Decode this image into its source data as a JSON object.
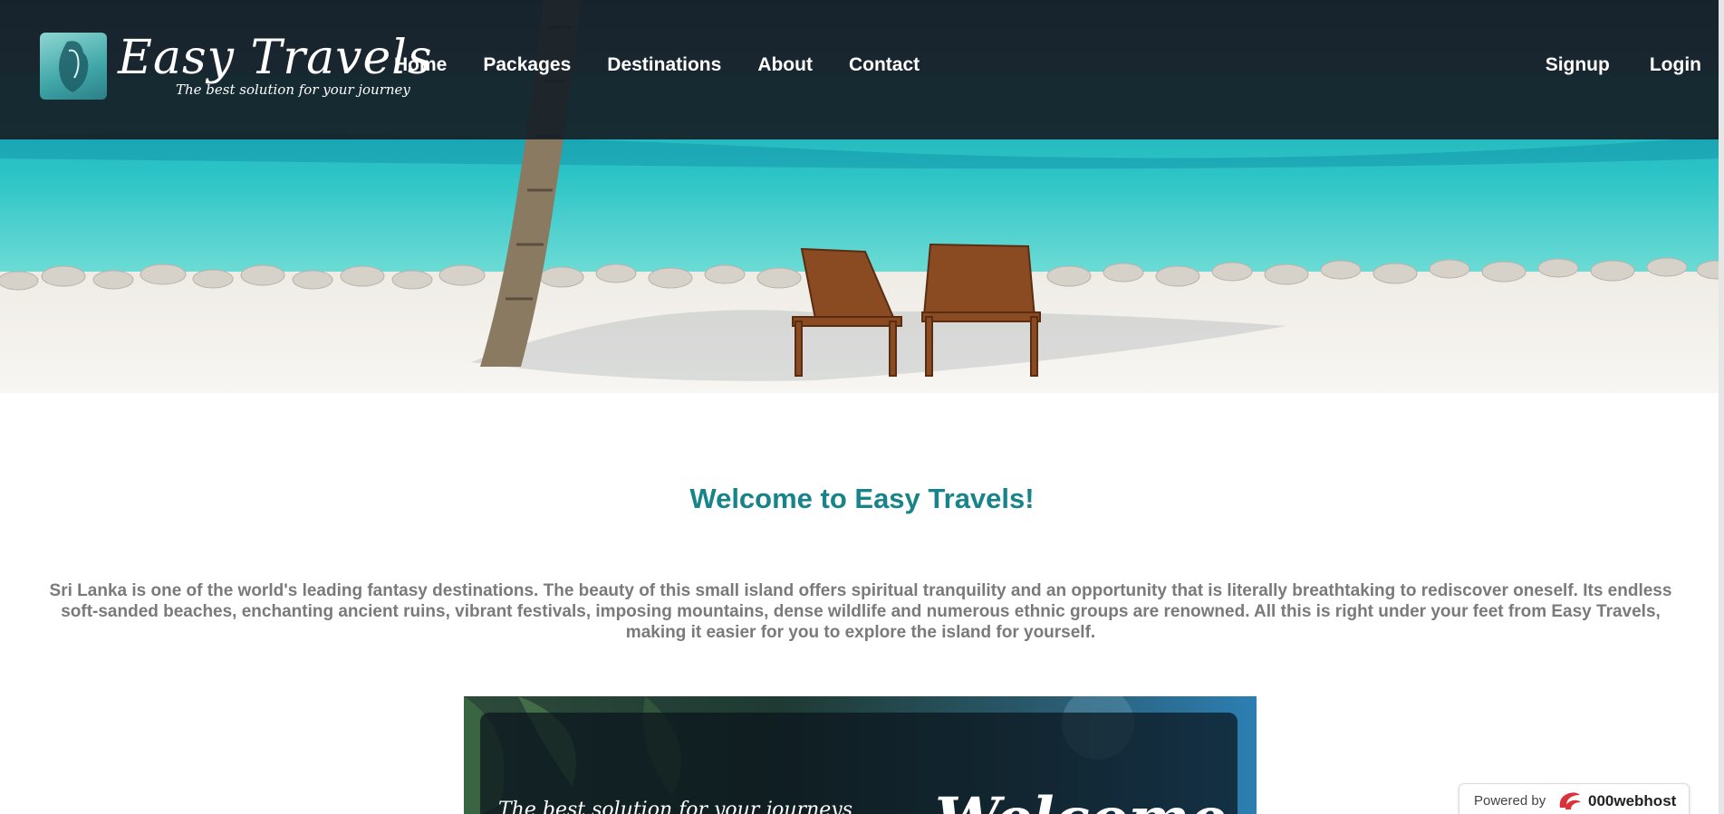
{
  "brand": {
    "name": "Easy Travels",
    "tagline": "The best solution for your journey"
  },
  "nav": {
    "items": [
      "Home",
      "Packages",
      "Destinations",
      "About",
      "Contact"
    ],
    "right_items": [
      "Signup",
      "Login"
    ]
  },
  "main": {
    "welcome_heading": "Welcome to Easy Travels!",
    "intro_paragraph": "Sri Lanka is one of the world's leading fantasy destinations. The beauty of this small island offers spiritual tranquility and an opportunity that is literally breathtaking to rediscover oneself. Its endless soft-sanded beaches, enchanting ancient ruins, vibrant festivals, imposing mountains, dense wildlife and numerous ethnic groups are renowned. All this is right under your feet from Easy Travels, making it easier for you to explore the island for yourself."
  },
  "promo_banner": {
    "tagline": "The best solution for your journeys",
    "headline": "Welcome"
  },
  "footer_badge": {
    "powered_by": "Powered by",
    "host_name": "000webhost"
  },
  "colors": {
    "accent": "#17848a",
    "navbar_bg": "#161e26",
    "body_text": "#7a7a7a"
  }
}
